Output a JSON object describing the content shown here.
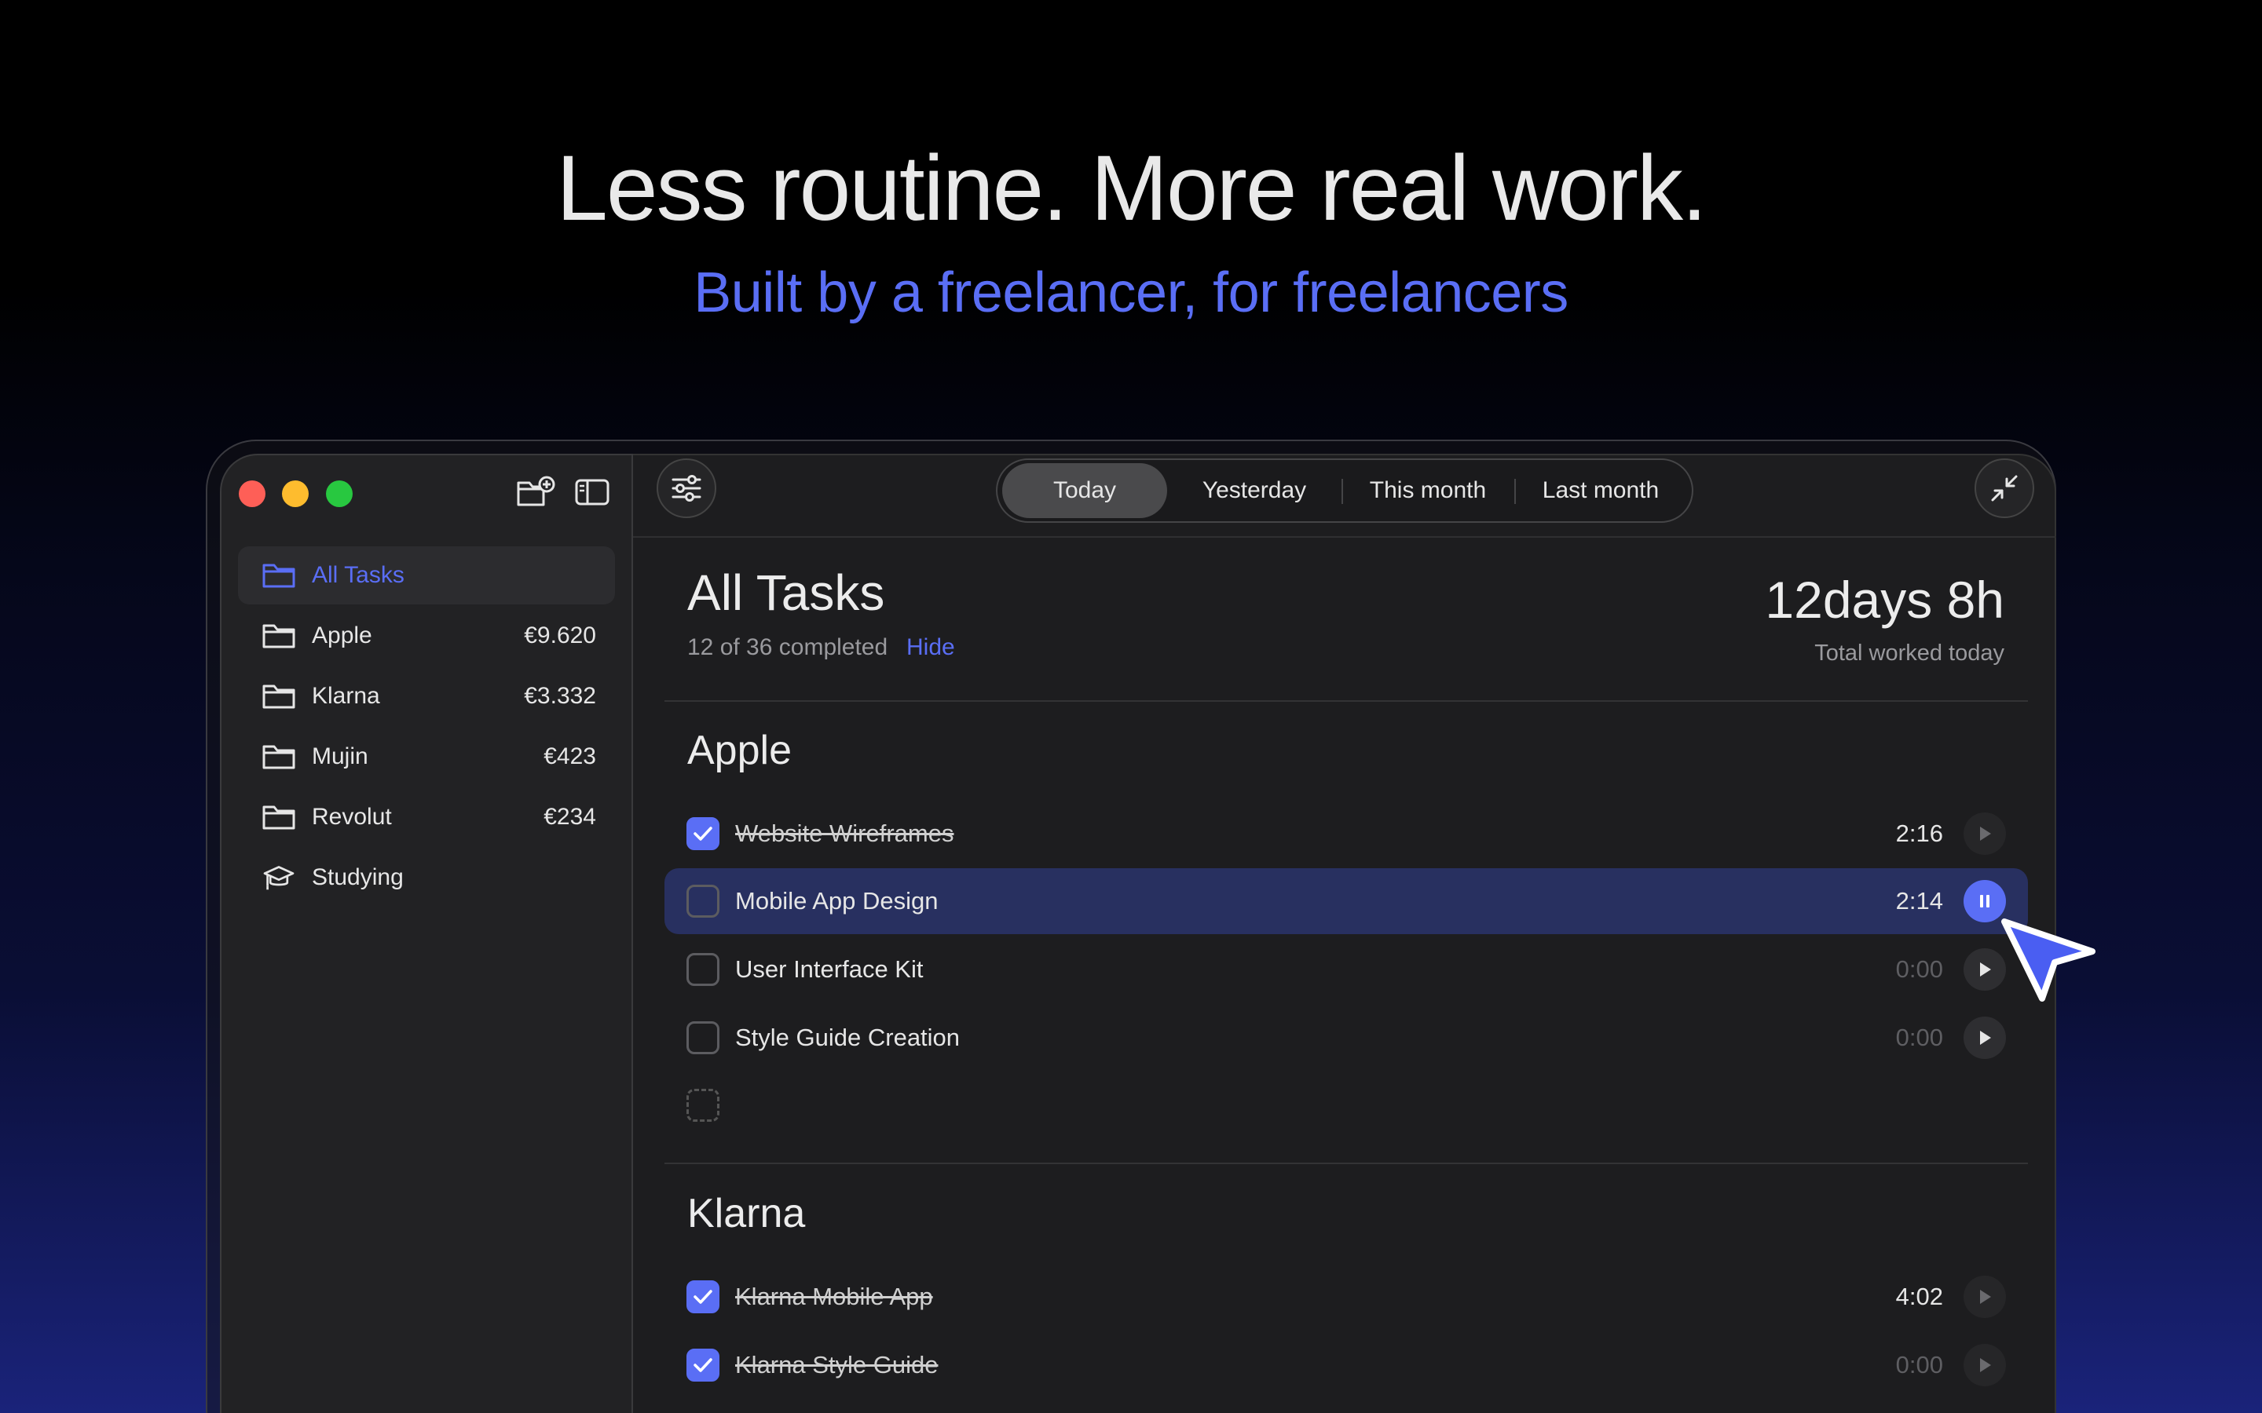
{
  "hero": {
    "title": "Less routine. More real work.",
    "subtitle": "Built by a freelancer, for freelancers"
  },
  "sidebar": {
    "items": [
      {
        "label": "All Tasks",
        "amount": "",
        "icon": "folder-icon",
        "active": true
      },
      {
        "label": "Apple",
        "amount": "€9.620",
        "icon": "folder-icon"
      },
      {
        "label": "Klarna",
        "amount": "€3.332",
        "icon": "folder-icon"
      },
      {
        "label": "Mujin",
        "amount": "€423",
        "icon": "folder-icon"
      },
      {
        "label": "Revolut",
        "amount": "€234",
        "icon": "folder-icon"
      },
      {
        "label": "Studying",
        "amount": "",
        "icon": "graduation-cap-icon"
      }
    ]
  },
  "toolbar": {
    "tabs": [
      "Today",
      "Yesterday",
      "This month",
      "Last month"
    ],
    "active_tab": "Today"
  },
  "main": {
    "title": "All Tasks",
    "progress": "12 of 36 completed",
    "hide_label": "Hide",
    "total_value": "12days 8h",
    "total_label": "Total worked today",
    "groups": [
      {
        "title": "Apple",
        "tasks": [
          {
            "label": "Website Wireframes",
            "time": "2:16",
            "done": true
          },
          {
            "label": "Mobile App Design",
            "time": "2:14",
            "done": false,
            "running": true
          },
          {
            "label": "User Interface Kit",
            "time": "0:00",
            "done": false
          },
          {
            "label": "Style Guide Creation",
            "time": "0:00",
            "done": false
          }
        ]
      },
      {
        "title": "Klarna",
        "tasks": [
          {
            "label": "Klarna Mobile App",
            "time": "4:02",
            "done": true
          },
          {
            "label": "Klarna Style Guide",
            "time": "0:00",
            "done": true
          }
        ]
      }
    ]
  },
  "colors": {
    "accent": "#5a6ef5",
    "running_row": "#283060",
    "close": "#fe5f57",
    "minimize": "#febc2e",
    "zoom": "#28c840"
  }
}
